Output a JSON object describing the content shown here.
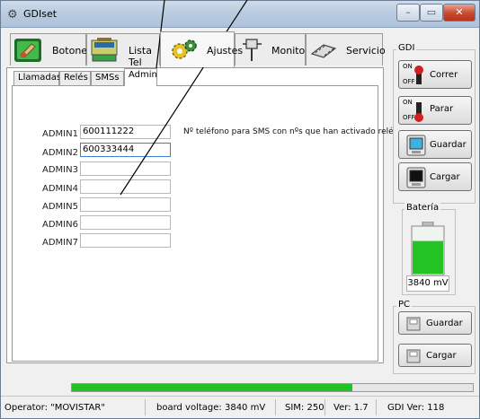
{
  "window": {
    "title": "GDIset",
    "minimize_label": "–",
    "maximize_label": "▭",
    "close_label": "✕"
  },
  "top_tabs": [
    {
      "label": "Botones"
    },
    {
      "label": "Lista Tel"
    },
    {
      "label": "Ajustes"
    },
    {
      "label": "Monitor"
    },
    {
      "label": "Servicio"
    }
  ],
  "sub_tabs": [
    {
      "label": "Llamadas"
    },
    {
      "label": "Relés"
    },
    {
      "label": "SMSs"
    },
    {
      "label": "Admin"
    }
  ],
  "admin": {
    "rows": [
      {
        "label": "ADMIN1",
        "value": "600111222"
      },
      {
        "label": "ADMIN2",
        "value": "600333444"
      },
      {
        "label": "ADMIN3",
        "value": ""
      },
      {
        "label": "ADMIN4",
        "value": ""
      },
      {
        "label": "ADMIN5",
        "value": ""
      },
      {
        "label": "ADMIN6",
        "value": ""
      },
      {
        "label": "ADMIN7",
        "value": ""
      }
    ],
    "note": "Nº teléfono para SMS con nºs que han activado relé"
  },
  "gdi_group": {
    "title": "GDI",
    "correr_label": "Correr",
    "parar_label": "Parar",
    "guardar_label": "Guardar",
    "cargar_label": "Cargar",
    "on_label": "ON",
    "off_label": "OFF"
  },
  "battery": {
    "title": "Batería",
    "voltage": "3840 mV",
    "level": 0.7
  },
  "pc_group": {
    "title": "PC",
    "guardar_label": "Guardar",
    "cargar_label": "Cargar"
  },
  "progress": {
    "fraction": 0.7
  },
  "status": {
    "operator": "Operator: \"MOVISTAR\"",
    "board_voltage": "board voltage: 3840 mV",
    "sim": "SIM: 250",
    "ver": "Ver: 1.7",
    "gdi_ver": "GDI Ver: 118"
  },
  "colors": {
    "battery_green": "#22c322",
    "accent_blue": "#3d7fd3"
  }
}
